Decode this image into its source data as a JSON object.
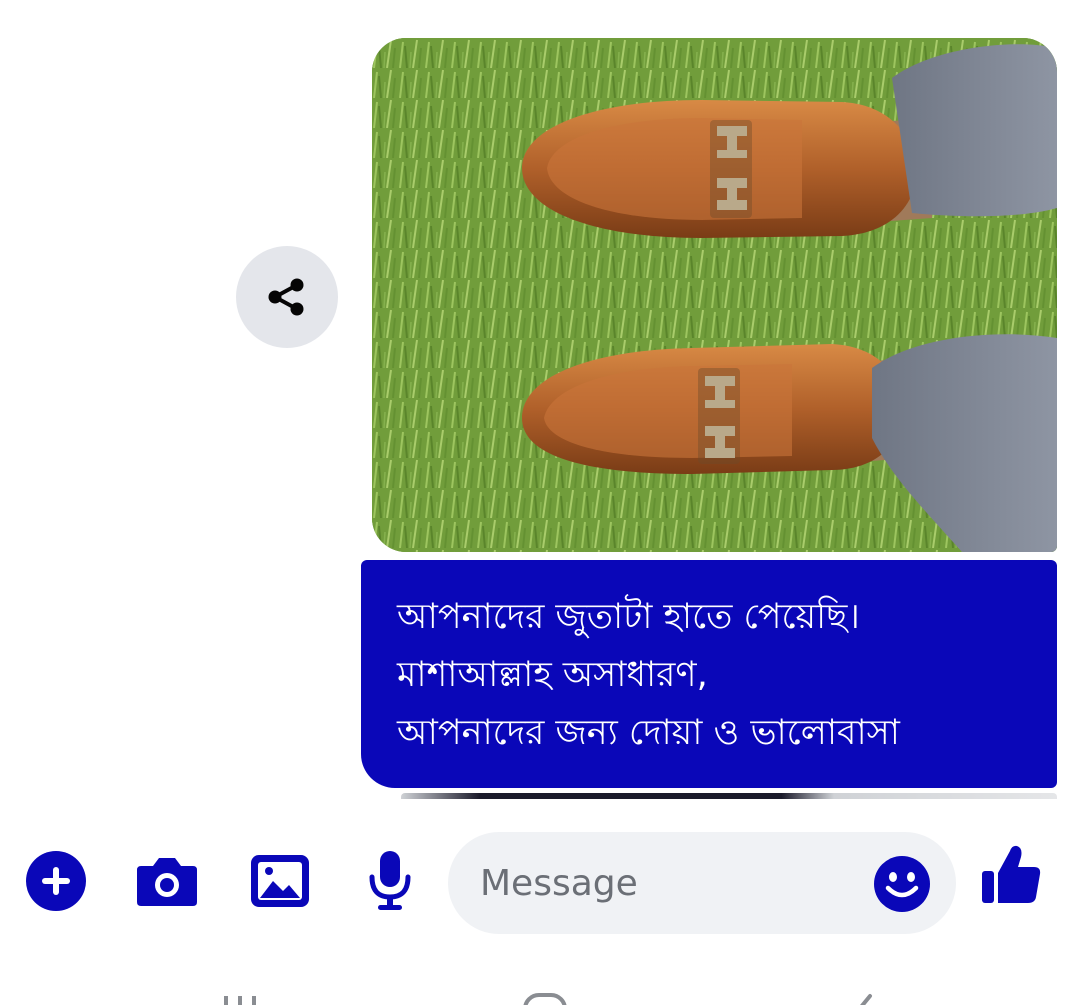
{
  "conversation": {
    "photo_message": {
      "icon": "photo-of-shoes"
    },
    "share_button": {
      "icon": "share-icon"
    },
    "text_message": {
      "lines": [
        "আপনাদের জুতাটা হাতে পেয়েছি।",
        "মাশাআল্লাহ অসাধারণ,",
        "আপনাদের জন্য দোয়া ও ভালোবাসা"
      ]
    }
  },
  "composer": {
    "actions": [
      "plus-icon",
      "camera-icon",
      "gallery-icon",
      "microphone-icon"
    ],
    "input_placeholder": "Message",
    "emoji_icon": "smiley-icon",
    "send_icon": "thumbs-up-icon"
  },
  "navigation": {
    "buttons": [
      "recents-icon",
      "home-icon",
      "back-icon"
    ]
  },
  "colors": {
    "accent": "#0a07b8",
    "bubble_text": "#ffffff",
    "input_background": "#f0f2f5",
    "share_background": "#e4e6eb"
  }
}
